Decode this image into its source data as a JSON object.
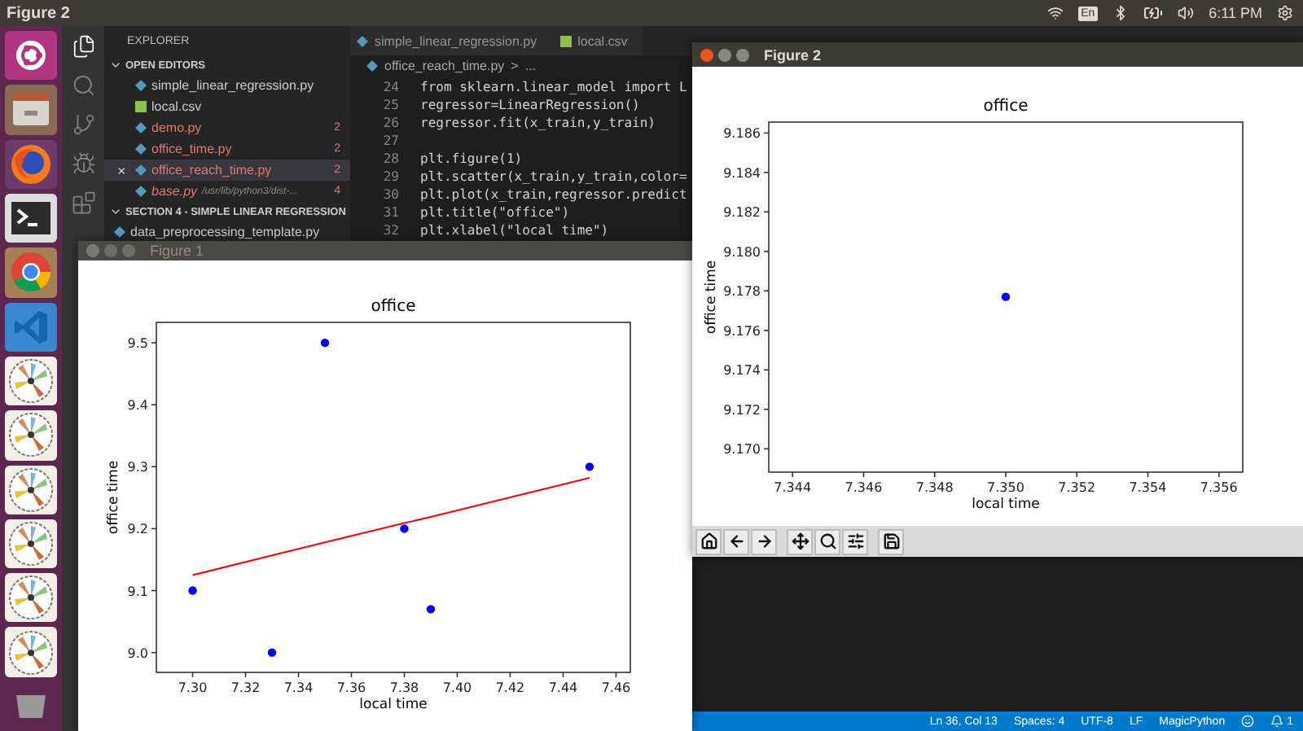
{
  "top_bar": {
    "title": "Figure 2",
    "keyboard": "En",
    "clock": "6:11 PM"
  },
  "launcher": [
    {
      "kind": "ubuntu"
    },
    {
      "kind": "files"
    },
    {
      "kind": "firefox"
    },
    {
      "kind": "terminal"
    },
    {
      "kind": "chrome"
    },
    {
      "kind": "vscode"
    },
    {
      "kind": "pinwheel"
    },
    {
      "kind": "pinwheel"
    },
    {
      "kind": "pinwheel"
    },
    {
      "kind": "pinwheel"
    },
    {
      "kind": "pinwheel"
    },
    {
      "kind": "pinwheel"
    },
    {
      "kind": "trash"
    }
  ],
  "editor": {
    "activity_bar": [
      {
        "kind": "files",
        "selected": true
      },
      {
        "kind": "search",
        "selected": false
      },
      {
        "kind": "source-control",
        "selected": false
      },
      {
        "kind": "debug",
        "selected": false
      },
      {
        "kind": "extensions",
        "selected": false
      }
    ],
    "sidebar": {
      "title": "EXPLORER",
      "sections": [
        {
          "title": "OPEN EDITORS",
          "expanded": true,
          "items": [
            {
              "name": "simple_linear_regression.py",
              "kind": "python",
              "selected": false,
              "error": false
            },
            {
              "name": "local.csv",
              "kind": "csv",
              "selected": false,
              "error": false
            },
            {
              "name": "demo.py",
              "kind": "python",
              "selected": false,
              "error": true,
              "badge": "2"
            },
            {
              "name": "office_time.py",
              "kind": "python",
              "selected": false,
              "error": true,
              "badge": "2"
            },
            {
              "name": "office_reach_time.py",
              "kind": "python",
              "selected": true,
              "error": true,
              "badge": "2",
              "close": "×"
            },
            {
              "name": "base.py",
              "kind": "python",
              "selected": false,
              "error": true,
              "preview": true,
              "path": "/usr/lib/python3/dist-...",
              "badge": "4"
            }
          ]
        },
        {
          "title": "SECTION 4 - SIMPLE LINEAR REGRESSION",
          "expanded": true,
          "items": [
            {
              "name": "data_preprocessing_template.py",
              "kind": "python",
              "selected": false,
              "error": false
            }
          ]
        }
      ]
    },
    "tabs": [
      {
        "name": "simple_linear_regression.py",
        "kind": "python",
        "selected": false
      },
      {
        "name": "local.csv",
        "kind": "csv",
        "selected": false
      }
    ],
    "breadcrumb": {
      "file": "office_reach_time.py",
      "separator": ">",
      "more": "..."
    },
    "code": [
      {
        "number": "24",
        "text": "from sklearn.linear_model import L"
      },
      {
        "number": "25",
        "text": "regressor=LinearRegression()"
      },
      {
        "number": "26",
        "text": "regressor.fit(x_train,y_train)"
      },
      {
        "number": "27"
      },
      {
        "number": "28",
        "text": "plt.figure(1)"
      },
      {
        "number": "29",
        "text": "plt.scatter(x_train,y_train,color="
      },
      {
        "number": "30",
        "text": "plt.plot(x_train,regressor.predict"
      },
      {
        "number": "31",
        "text": "plt.title(\"office\")"
      },
      {
        "number": "32",
        "text": "plt.xlabel(\"local time\")"
      }
    ],
    "status_bar": {
      "items": [
        "Ln 36, Col 13",
        "Spaces: 4",
        "UTF-8",
        "LF",
        "MagicPython"
      ],
      "notifications": "1"
    }
  },
  "figures": [
    {
      "title": "Figure 1",
      "active": false,
      "chart_data": {
        "type": "scatter",
        "title": "office",
        "xlabel": "local time",
        "ylabel": "office time",
        "x": [
          7.3,
          7.33,
          7.35,
          7.38,
          7.39,
          7.45
        ],
        "series": [
          {
            "type": "scatter",
            "color": "#0000ff",
            "values": [
              9.1,
              9.0,
              9.5,
              9.2,
              9.07,
              9.3
            ]
          },
          {
            "type": "line",
            "color": "#ff0000",
            "values": [
              9.125,
              9.157,
              9.178,
              9.209,
              9.219,
              9.282
            ]
          }
        ],
        "xlim": [
          7.2863,
          7.4654
        ],
        "ylim": [
          8.968,
          9.533
        ],
        "xticks": [
          {
            "value": 7.3,
            "label": "7.30"
          },
          {
            "value": 7.32,
            "label": "7.32"
          },
          {
            "value": 7.34,
            "label": "7.34"
          },
          {
            "value": 7.36,
            "label": "7.36"
          },
          {
            "value": 7.38,
            "label": "7.38"
          },
          {
            "value": 7.4,
            "label": "7.40"
          },
          {
            "value": 7.42,
            "label": "7.42"
          },
          {
            "value": 7.44,
            "label": "7.44"
          },
          {
            "value": 7.46,
            "label": "7.46"
          }
        ],
        "yticks": [
          {
            "value": 9.0,
            "label": "9.0"
          },
          {
            "value": 9.1,
            "label": "9.1"
          },
          {
            "value": 9.2,
            "label": "9.2"
          },
          {
            "value": 9.3,
            "label": "9.3"
          },
          {
            "value": 9.4,
            "label": "9.4"
          },
          {
            "value": 9.5,
            "label": "9.5"
          }
        ]
      }
    },
    {
      "title": "Figure 2",
      "active": true,
      "chart_data": {
        "type": "scatter",
        "title": "office",
        "xlabel": "local time",
        "ylabel": "office time",
        "x": [
          7.35
        ],
        "series": [
          {
            "type": "scatter",
            "color": "#0000ff",
            "values": [
              9.1777
            ]
          }
        ],
        "xlim": [
          7.34333,
          7.35667
        ],
        "ylim": [
          9.16882,
          9.18655
        ],
        "xticks": [
          {
            "value": 7.344,
            "label": "7.344"
          },
          {
            "value": 7.346,
            "label": "7.346"
          },
          {
            "value": 7.348,
            "label": "7.348"
          },
          {
            "value": 7.35,
            "label": "7.350"
          },
          {
            "value": 7.352,
            "label": "7.352"
          },
          {
            "value": 7.354,
            "label": "7.354"
          },
          {
            "value": 7.356,
            "label": "7.356"
          }
        ],
        "yticks": [
          {
            "value": 9.17,
            "label": "9.170"
          },
          {
            "value": 9.172,
            "label": "9.172"
          },
          {
            "value": 9.174,
            "label": "9.174"
          },
          {
            "value": 9.176,
            "label": "9.176"
          },
          {
            "value": 9.178,
            "label": "9.178"
          },
          {
            "value": 9.18,
            "label": "9.180"
          },
          {
            "value": 9.182,
            "label": "9.182"
          },
          {
            "value": 9.184,
            "label": "9.184"
          },
          {
            "value": 9.186,
            "label": "9.186"
          }
        ]
      },
      "toolbar": [
        [
          {
            "kind": "home"
          },
          {
            "kind": "back"
          },
          {
            "kind": "forward"
          }
        ],
        [
          {
            "kind": "pan"
          },
          {
            "kind": "zoom"
          },
          {
            "kind": "configure"
          }
        ],
        [
          {
            "kind": "save"
          }
        ]
      ]
    }
  ]
}
